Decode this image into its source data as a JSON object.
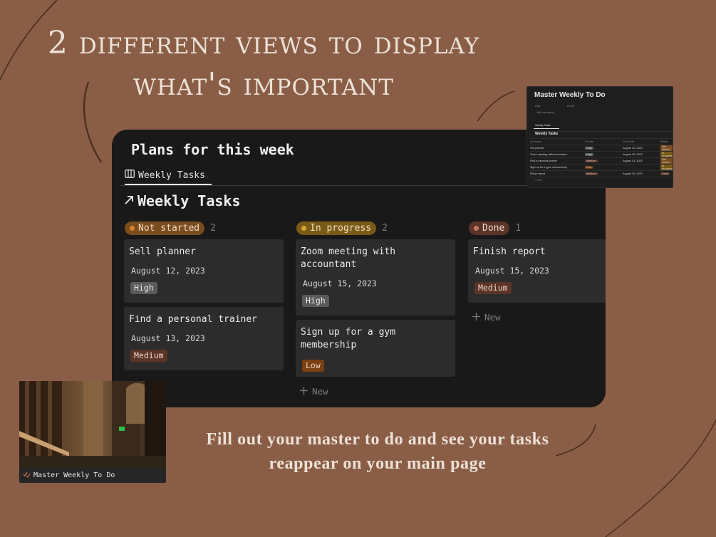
{
  "headline": {
    "line1": "2 different views to display",
    "line2": "what's important"
  },
  "caption": {
    "line1": "Fill out your master to do and see your tasks",
    "line2": "reappear on your main page"
  },
  "colors": {
    "background": "#8a5e46",
    "panel": "#191919",
    "card": "#2c2c2c"
  },
  "board": {
    "page_title": "Plans for this week",
    "view_tab": {
      "icon": "board-view-icon",
      "label": "Weekly Tasks"
    },
    "title": "Weekly Tasks",
    "title_icon": "arrow-up-right-icon",
    "new_label": "New",
    "columns": [
      {
        "status": "Not started",
        "count": "2",
        "pill_bg": "#7a4d1f",
        "dot": "#d9822b",
        "cards": [
          {
            "title": "Sell planner",
            "date": "August 12, 2023",
            "priority": "High",
            "tag_bg": "#5a5a5a"
          },
          {
            "title": "Find a personal trainer",
            "date": "August 13, 2023",
            "priority": "Medium",
            "tag_bg": "#5b3427"
          }
        ]
      },
      {
        "status": "In progress",
        "count": "2",
        "pill_bg": "#7a5a18",
        "dot": "#d4a72c",
        "cards": [
          {
            "title": "Zoom meeting with accountant",
            "date": "August 15, 2023",
            "priority": "High",
            "tag_bg": "#5a5a5a"
          },
          {
            "title": "Sign up for a gym membership",
            "date": "",
            "priority": "Low",
            "tag_bg": "#7a3f12"
          }
        ]
      },
      {
        "status": "Done",
        "count": "1",
        "pill_bg": "#5b3427",
        "dot": "#c4786a",
        "cards": [
          {
            "title": "Finish report",
            "date": "August 15, 2023",
            "priority": "Medium",
            "tag_bg": "#5b3427"
          }
        ]
      }
    ]
  },
  "mini_table": {
    "title": "Master Weekly To Do",
    "prop_date": "Date",
    "prop_empty": "Empty",
    "add_property": "+ Add a property",
    "tab": "Weekly Tasks",
    "table_title": "Weekly Tasks",
    "headers": [
      "Aa Name",
      "Priority",
      "Due Date",
      "Status"
    ],
    "rows": [
      [
        "Sell planner",
        "High",
        "August 12, 2023",
        "Not started"
      ],
      [
        "Zoom meeting with accountant",
        "High",
        "August 15, 2023",
        "In progress"
      ],
      [
        "Find a personal trainer",
        "Medium",
        "August 13, 2023",
        "Not started"
      ],
      [
        "Sign up for a gym membership",
        "Low",
        "",
        "In progress"
      ],
      [
        "Finish report",
        "Medium",
        "August 15, 2023",
        "Done"
      ]
    ],
    "new_label": "+ New"
  },
  "thumbnail": {
    "label": "Master Weekly To Do",
    "icon": "checklist-icon"
  }
}
